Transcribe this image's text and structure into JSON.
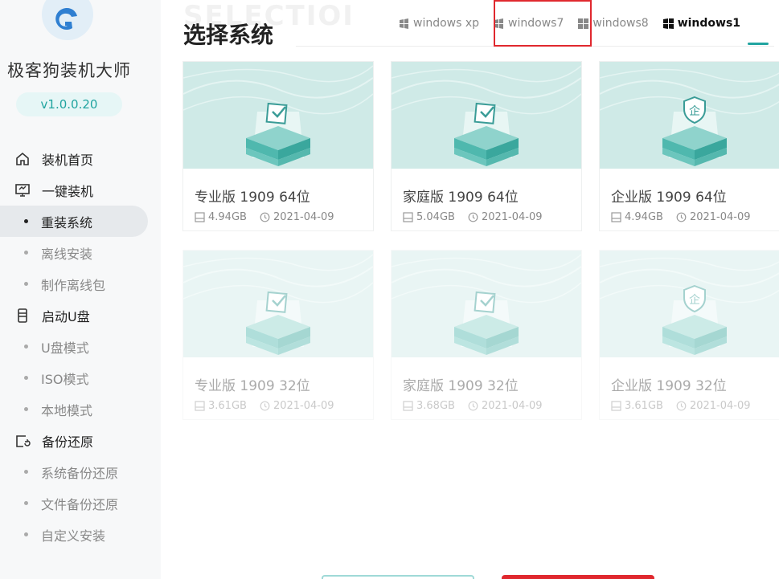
{
  "app": {
    "name": "极客狗装机大师",
    "version": "v1.0.0.20"
  },
  "nav": {
    "home": "装机首页",
    "one_key": "一键装机",
    "reinstall": "重装系统",
    "offline_install": "离线安装",
    "make_offline": "制作离线包",
    "usb_boot": "启动U盘",
    "usb_mode": "U盘模式",
    "iso_mode": "ISO模式",
    "local_mode": "本地模式",
    "backup": "备份还原",
    "sys_backup": "系统备份还原",
    "file_backup": "文件备份还原",
    "custom_install": "自定义安装"
  },
  "main": {
    "bg_word": "SELECTIOI",
    "title": "选择系统",
    "tabs": [
      {
        "label": "windows xp"
      },
      {
        "label": "windows7"
      },
      {
        "label": "windows8"
      },
      {
        "label": "windows1"
      }
    ],
    "active_tab": 3,
    "highlighted_tab": 1
  },
  "cards": [
    {
      "name": "专业版 1909 64位",
      "size": "4.94GB",
      "date": "2021-04-09",
      "badge": "check"
    },
    {
      "name": "家庭版 1909 64位",
      "size": "5.04GB",
      "date": "2021-04-09",
      "badge": "check"
    },
    {
      "name": "企业版 1909 64位",
      "size": "4.94GB",
      "date": "2021-04-09",
      "badge": "企"
    },
    {
      "name": "专业版 1909 32位",
      "size": "3.61GB",
      "date": "2021-04-09",
      "badge": "check"
    },
    {
      "name": "家庭版 1909 32位",
      "size": "3.68GB",
      "date": "2021-04-09",
      "badge": "check"
    },
    {
      "name": "企业版 1909 32位",
      "size": "3.61GB",
      "date": "2021-04-09",
      "badge": "企"
    }
  ],
  "colors": {
    "accent": "#21a4a0",
    "highlight": "#e0282e",
    "thumb_bg": "#cfeae7"
  }
}
